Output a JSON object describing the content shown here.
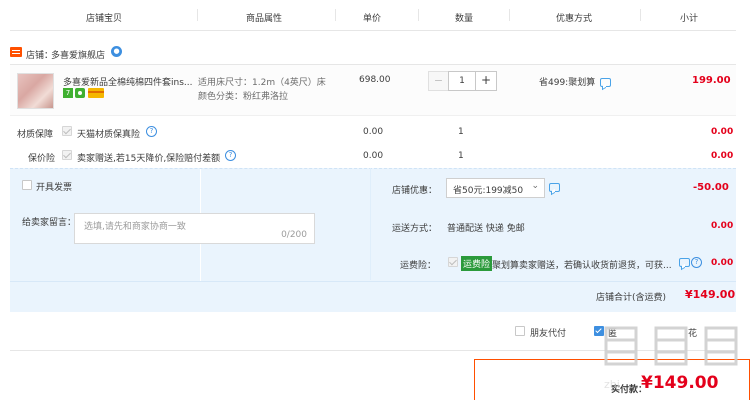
{
  "header": {
    "col_product": "店铺宝贝",
    "col_attr": "商品属性",
    "col_price": "单价",
    "col_qty": "数量",
    "col_discount": "优惠方式",
    "col_subtotal": "小计"
  },
  "shop": {
    "label": "店铺：",
    "name": "多喜爱旗舰店"
  },
  "item": {
    "title": "多喜爱新品全棉纯棉四件套ins...",
    "attr_size": "适用床尺寸：1.2m（4英尺）床",
    "attr_color": "颜色分类：粉红弗洛拉",
    "unit_price": "698.00",
    "quantity": "1",
    "discount": "省499:聚划算",
    "subtotal": "199.00",
    "badge1": "7",
    "badge2": "",
    "badge3": ""
  },
  "services": [
    {
      "label": "材质保障",
      "name": "天猫材质保真险",
      "price": "0.00",
      "qty": "1",
      "subtotal": "0.00"
    },
    {
      "label": "保价险",
      "name": "卖家赠送,若15天降价,保险赔付差额",
      "price": "0.00",
      "qty": "1",
      "subtotal": "0.00"
    }
  ],
  "invoice": {
    "label": "开具发票"
  },
  "message": {
    "label": "给卖家留言：",
    "placeholder": "选填,请先和商家协商一致",
    "counter": "0/200"
  },
  "shop_discount": {
    "label": "店铺优惠：",
    "value": "省50元:199减50",
    "amount": "-50.00"
  },
  "shipping": {
    "label": "运送方式：",
    "value": "普通配送 快递 免邮",
    "amount": "0.00"
  },
  "freight_insurance": {
    "label": "运费险：",
    "badge": "运费险",
    "text": "聚划算卖家赠送，若确认收货前退货，可获...",
    "amount": "0.00"
  },
  "shop_total": {
    "label": "店铺合计(含运费)",
    "amount": "¥149.00"
  },
  "footer": {
    "friend_pay": "朋友代付",
    "anon_partial": "匿",
    "other_partial": "花",
    "actual_pay_label": "实付款：",
    "actual_pay_amount": "¥149.00",
    "watermark": "值|值|值",
    "watermark_url": "zhi"
  },
  "colors": {
    "accent_red": "#e4001b",
    "blue": "#3d8fe0",
    "light_blue_bg": "#eaf4fd"
  }
}
